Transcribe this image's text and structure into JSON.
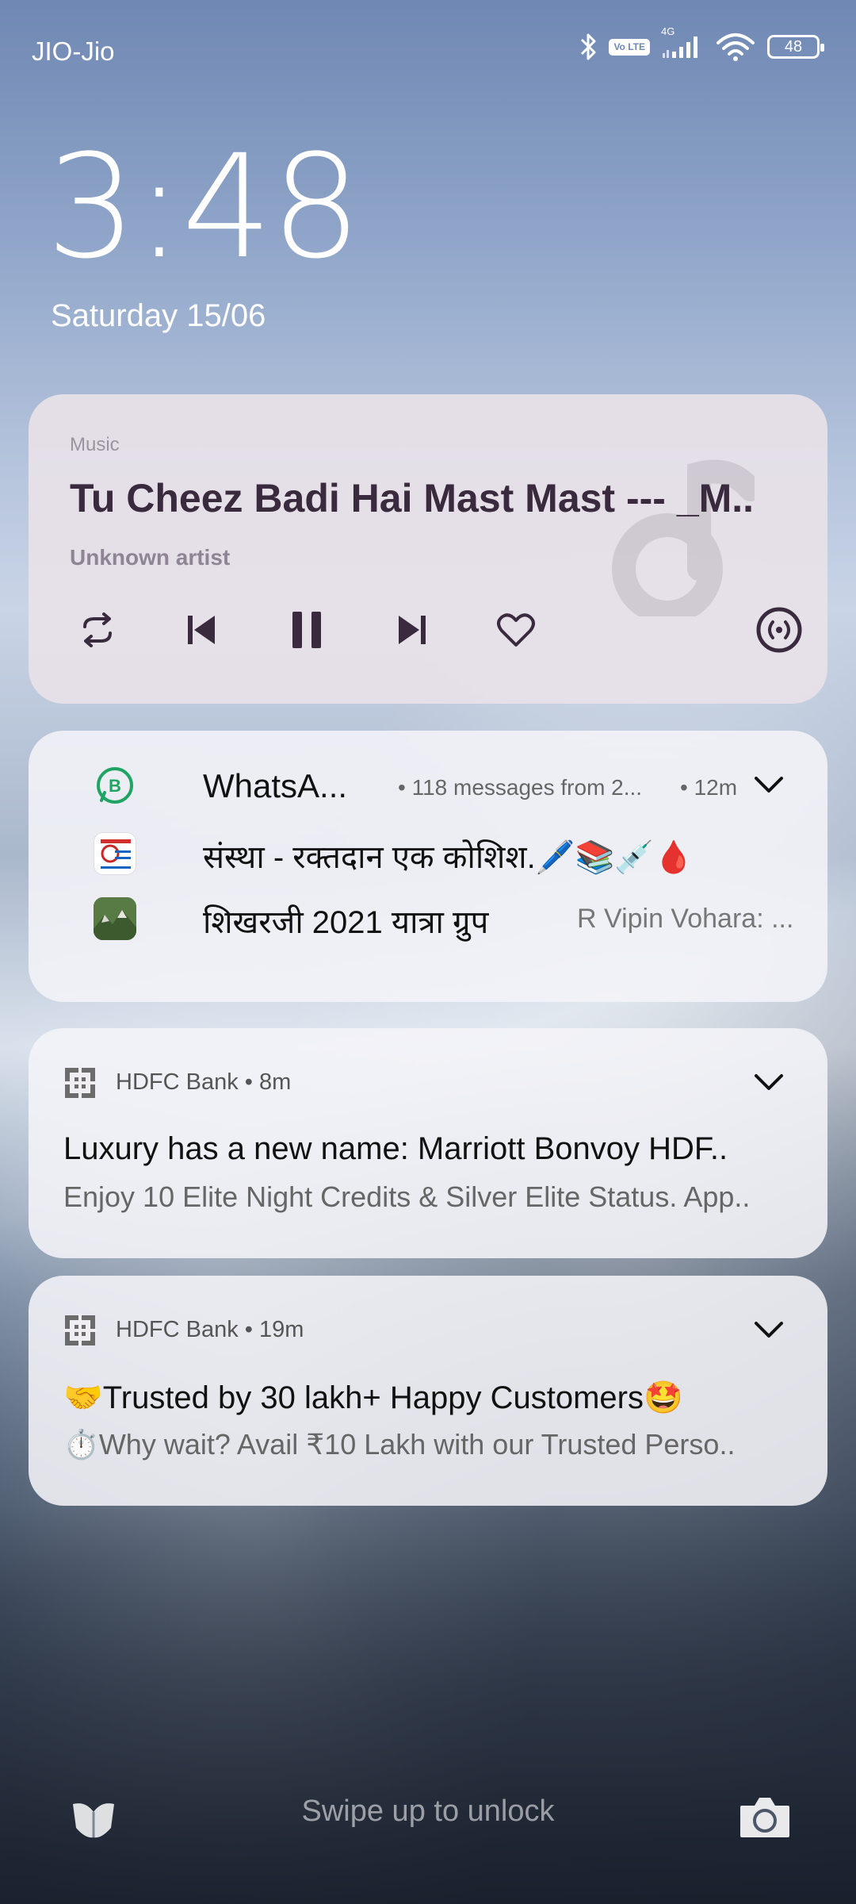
{
  "status_bar": {
    "carrier": "JIO-Jio",
    "network": "4G",
    "volte": "Vo LTE",
    "battery": "48",
    "icons": [
      "bluetooth-icon",
      "volte-icon",
      "signal-icon",
      "wifi-icon",
      "battery-icon"
    ]
  },
  "clock": {
    "time": "3:48",
    "date": "Saturday 15/06"
  },
  "music": {
    "app": "Music",
    "title": "Tu Cheez Badi Hai Mast Mast --- _M..",
    "artist": "Unknown artist",
    "controls": [
      "repeat-icon",
      "previous-icon",
      "pause-icon",
      "next-icon",
      "heart-icon",
      "cast-icon"
    ]
  },
  "whatsapp": {
    "app": "WhatsA...",
    "meta": "• 118 messages from 2...",
    "time": "• 12m",
    "conversations": [
      {
        "title": "संस्था - रक्तदान एक कोशिश.🖊️📚💉🩸"
      },
      {
        "title": "शिखरजी  2021 यात्रा ग्रुप",
        "preview": "R Vipin Vohara: ..."
      }
    ]
  },
  "notifications": [
    {
      "app": "HDFC Bank",
      "time": "• 8m",
      "title": "Luxury has a new name: Marriott Bonvoy HDF..",
      "body": "Enjoy 10 Elite Night Credits & Silver Elite Status. App.."
    },
    {
      "app": "HDFC Bank",
      "time": "• 19m",
      "title": "🤝Trusted by 30 lakh+ Happy Customers🤩",
      "body": "⏱️Why wait? Avail ₹10 Lakh with our Trusted Perso.."
    }
  ],
  "lockscreen": {
    "swipe_hint": "Swipe up to unlock"
  },
  "colors": {
    "music_title": "#3a2a3e",
    "whatsapp_green": "#1fa463",
    "card_bg": "#f0eef2"
  }
}
